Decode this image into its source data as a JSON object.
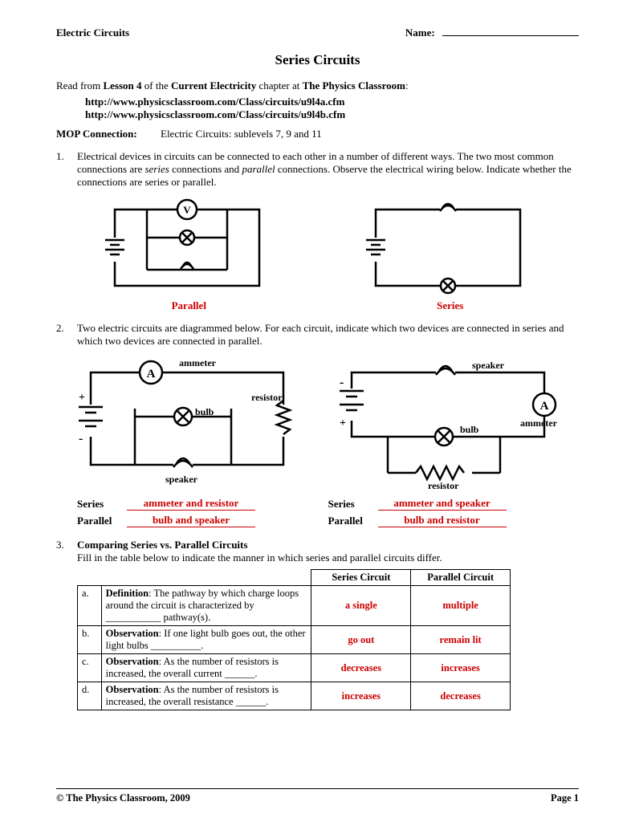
{
  "header": {
    "subject": "Electric Circuits",
    "name_label": "Name:"
  },
  "title": "Series Circuits",
  "intro": {
    "prefix": "Read from ",
    "lesson": "Lesson 4",
    "mid": " of the ",
    "chapter": "Current Electricity",
    "mid2": " chapter at ",
    "site": "The Physics Classroom",
    "suffix": ":"
  },
  "urls": [
    "http://www.physicsclassroom.com/Class/circuits/u9l4a.cfm",
    "http://www.physicsclassroom.com/Class/circuits/u9l4b.cfm"
  ],
  "mop": {
    "label": "MOP Connection:",
    "text": "Electric Circuits:  sublevels 7, 9 and 11"
  },
  "q1": {
    "num": "1.",
    "pre": "Electrical devices in circuits can be connected to each other in a number of different ways.  The two most common connections are ",
    "series_i": "series",
    "mid": " connections and ",
    "parallel_i": "parallel",
    "post": " connections.  Observe the electrical wiring below.  Indicate whether the connections are series or parallel.",
    "label_left": "Parallel",
    "label_right": "Series"
  },
  "q2": {
    "num": "2.",
    "text": "Two electric circuits are diagrammed below.  For each circuit, indicate which two devices are connected in series and which two devices are connected in parallel.",
    "labels": {
      "ammeter": "ammeter",
      "resistor": "resistor",
      "bulb": "bulb",
      "speaker": "speaker"
    },
    "answers": {
      "left_series_label": "Series",
      "left_series": "ammeter and resistor",
      "left_par_label": "Parallel",
      "left_par": "bulb and speaker",
      "right_series_label": "Series",
      "right_series": "ammeter and speaker",
      "right_par_label": "Parallel",
      "right_par": "bulb and resistor"
    }
  },
  "q3": {
    "num": "3.",
    "heading": "Comparing Series vs. Parallel Circuits",
    "instruction": "Fill in the table below to indicate the manner in which series and parallel circuits differ.",
    "th_series": "Series Circuit",
    "th_parallel": "Parallel Circuit",
    "rows": [
      {
        "letter": "a.",
        "desc_b": "Definition",
        "desc": ":  The pathway by which charge loops around the circuit is characterized by ___________ pathway(s).",
        "series": "a single",
        "parallel": "multiple"
      },
      {
        "letter": "b.",
        "desc_b": "Observation",
        "desc": ":  If one light bulb goes out, the other light bulbs __________.",
        "series": "go out",
        "parallel": "remain lit"
      },
      {
        "letter": "c.",
        "desc_b": "Observation",
        "desc": ":  As the number of resistors is increased, the overall current ______.",
        "series": "decreases",
        "parallel": "increases"
      },
      {
        "letter": "d.",
        "desc_b": "Observation",
        "desc": ":  As the number of resistors is increased, the overall resistance ______.",
        "series": "increases",
        "parallel": "decreases"
      }
    ]
  },
  "footer": {
    "copyright": "©  The Physics Classroom, 2009",
    "page": "Page 1"
  }
}
